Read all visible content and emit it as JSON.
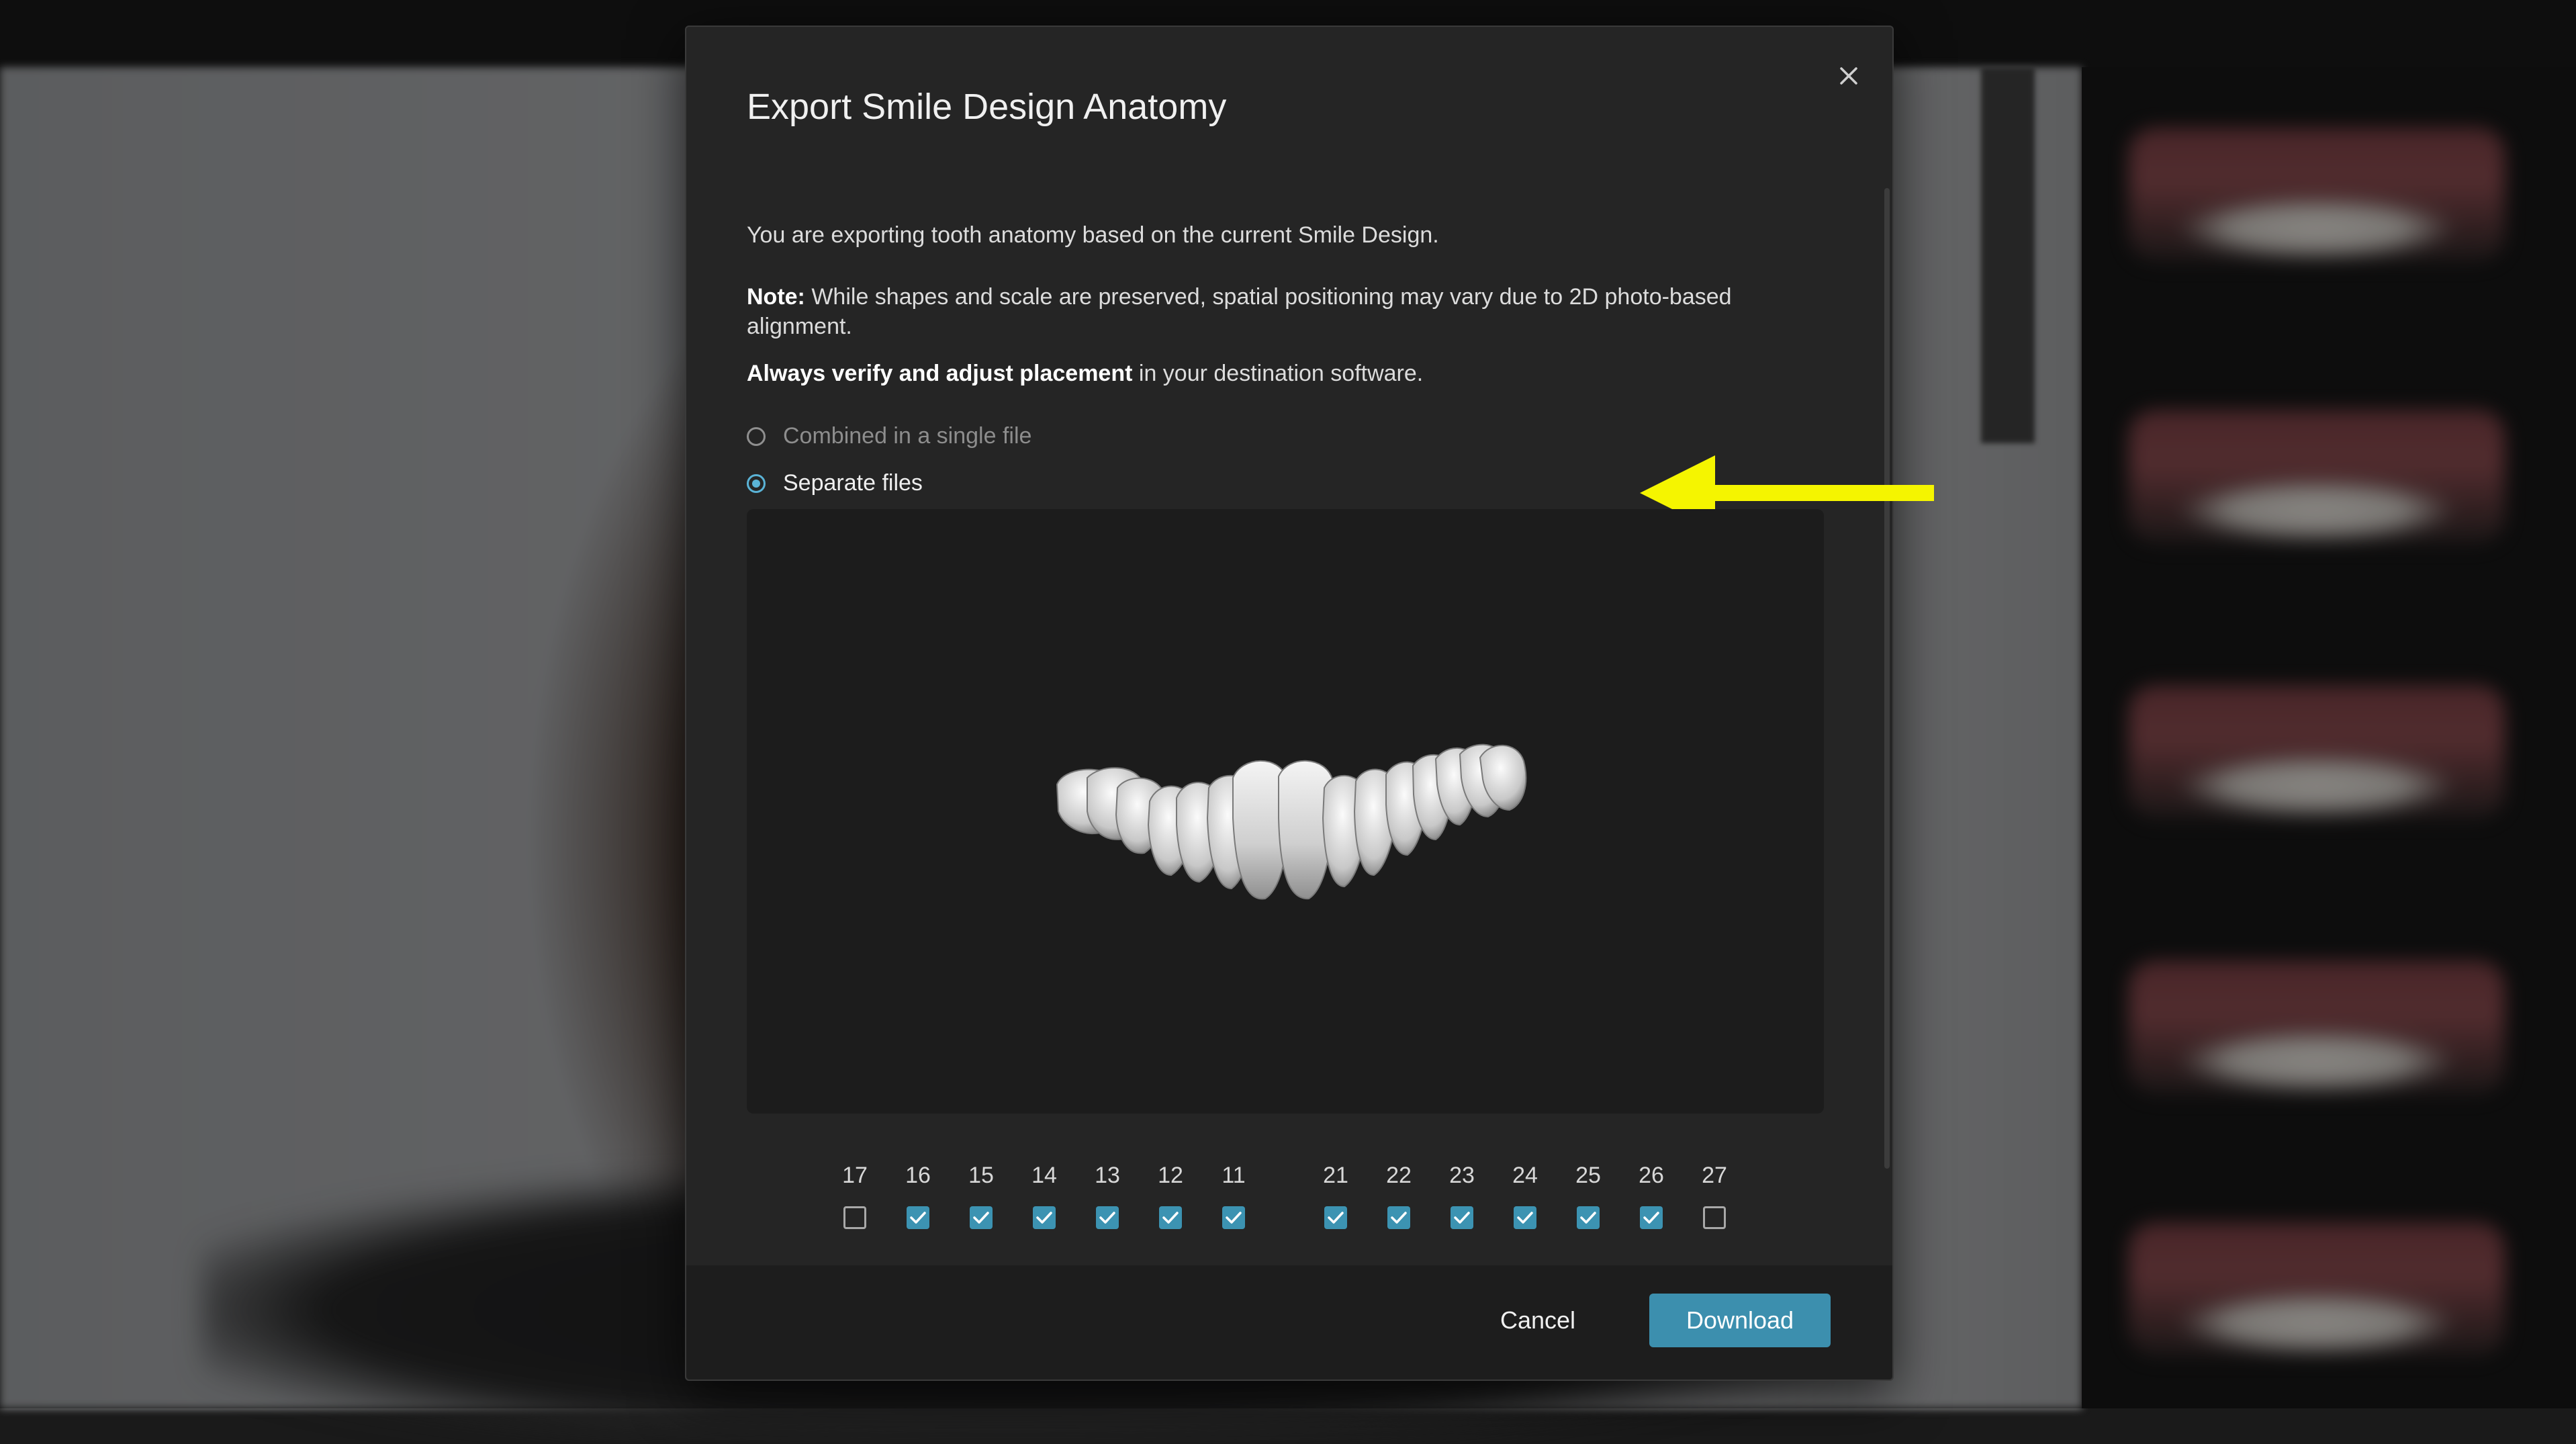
{
  "dialog": {
    "title": "Export Smile Design Anatomy",
    "close_icon": "close-icon",
    "intro": "You are exporting tooth anatomy based on the current Smile Design.",
    "note_label": "Note:",
    "note_text": " While shapes and scale are preserved, spatial positioning may vary due to 2D photo-based alignment.",
    "verify_bold": "Always verify and adjust placement",
    "verify_text": " in your destination software.",
    "options": [
      {
        "label": "Combined in a single file",
        "selected": false
      },
      {
        "label": "Separate files",
        "selected": true
      }
    ],
    "teeth": [
      {
        "number": "17",
        "checked": false
      },
      {
        "number": "16",
        "checked": true
      },
      {
        "number": "15",
        "checked": true
      },
      {
        "number": "14",
        "checked": true
      },
      {
        "number": "13",
        "checked": true
      },
      {
        "number": "12",
        "checked": true
      },
      {
        "number": "11",
        "checked": true
      },
      {
        "number": "21",
        "checked": true
      },
      {
        "number": "22",
        "checked": true
      },
      {
        "number": "23",
        "checked": true
      },
      {
        "number": "24",
        "checked": true
      },
      {
        "number": "25",
        "checked": true
      },
      {
        "number": "26",
        "checked": true
      },
      {
        "number": "27",
        "checked": false
      }
    ],
    "footer": {
      "cancel_label": "Cancel",
      "download_label": "Download"
    }
  },
  "colors": {
    "accent": "#3c8fae",
    "checkbox_checked": "#3c93b2",
    "radio_selected": "#5ab3d6",
    "annotation_arrow": "#f5f500",
    "dialog_bg": "#252525"
  }
}
